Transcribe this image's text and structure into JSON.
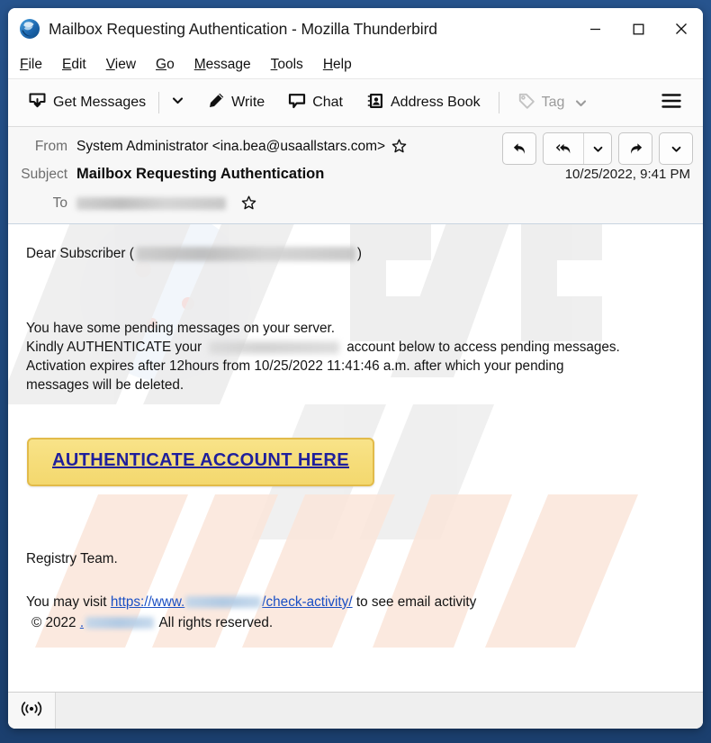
{
  "window": {
    "title": "Mailbox Requesting Authentication - Mozilla Thunderbird",
    "logo_icon": "thunderbird-logo-icon",
    "controls": {
      "minimize": "minimize-icon",
      "maximize": "maximize-icon",
      "close": "close-icon"
    }
  },
  "menubar": {
    "items": [
      {
        "label": "File",
        "accesskey": "F",
        "rest": "ile"
      },
      {
        "label": "Edit",
        "accesskey": "E",
        "rest": "dit"
      },
      {
        "label": "View",
        "accesskey": "V",
        "rest": "iew"
      },
      {
        "label": "Go",
        "accesskey": "G",
        "rest": "o"
      },
      {
        "label": "Message",
        "accesskey": "M",
        "rest": "essage"
      },
      {
        "label": "Tools",
        "accesskey": "T",
        "rest": "ools"
      },
      {
        "label": "Help",
        "accesskey": "H",
        "rest": "elp"
      }
    ]
  },
  "toolbar": {
    "get_messages": "Get Messages",
    "get_messages_icon": "download-mail-icon",
    "get_messages_caret": "chevron-down-icon",
    "write": "Write",
    "write_icon": "pencil-icon",
    "chat": "Chat",
    "chat_icon": "speech-bubble-icon",
    "address_book": "Address Book",
    "address_book_icon": "address-book-icon",
    "tag": "Tag",
    "tag_icon": "tag-icon",
    "tag_caret": "chevron-down-icon",
    "app_menu_icon": "hamburger-menu-icon"
  },
  "message_header": {
    "from_label": "From",
    "from_value": "System Administrator <ina.bea@usaallstars.com>",
    "from_star_icon": "star-outline-icon",
    "subject_label": "Subject",
    "subject_value": "Mailbox Requesting Authentication",
    "to_label": "To",
    "to_value_redacted": "",
    "to_star_icon": "star-outline-icon",
    "date": "10/25/2022, 9:41 PM",
    "actions": {
      "reply_icon": "reply-arrow-icon",
      "reply_all_icon": "reply-all-arrow-icon",
      "reply_all_caret": "chevron-down-icon",
      "forward_icon": "forward-arrow-icon",
      "more_caret": "chevron-down-icon"
    }
  },
  "body": {
    "greeting_prefix": "Dear Subscriber (",
    "greeting_suffix": ")",
    "line1": "You have some pending messages on your server.",
    "line2_part1": "Kindly AUTHENTICATE your",
    "line2_part2": "account below to access pending messages.",
    "line3": "Activation expires after 12hours from 10/25/2022 11:41:46 a.m. after which your pending",
    "line4": "messages will be deleted.",
    "cta_label": "AUTHENTICATE ACCOUNT HERE",
    "signature": "Registry Team.",
    "footer_prefix": "You may visit",
    "footer_link_start": "https://www.",
    "footer_link_end": "/check-activity/",
    "footer_suffix": "to see email activity",
    "copyright_prefix": "© 2022",
    "copyright_dot": ".",
    "copyright_suffix": "All rights reserved."
  },
  "statusbar": {
    "connection_icon": "broadcast-signal-icon",
    "status_text": ""
  },
  "colors": {
    "window_frame": "#1d4679",
    "header_bg": "#f7f7f7",
    "cta_bg": "#f6dd7a",
    "cta_border": "#e2bb4a",
    "cta_text": "#1f1f9c",
    "link": "#1a4fc4"
  }
}
